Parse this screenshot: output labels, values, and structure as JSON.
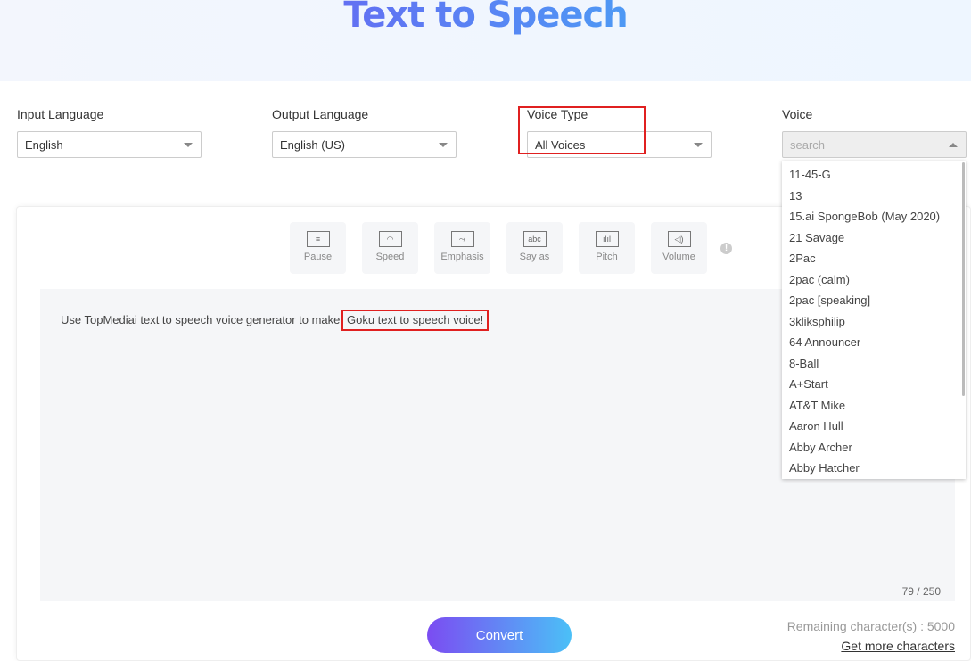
{
  "header": {
    "title": "Text to Speech"
  },
  "fields": {
    "input_language": {
      "label": "Input Language",
      "value": "English"
    },
    "output_language": {
      "label": "Output Language",
      "value": "English (US)"
    },
    "voice_type": {
      "label": "Voice Type",
      "value": "All Voices"
    },
    "voice": {
      "label": "Voice",
      "placeholder": "search"
    }
  },
  "voice_options": [
    "11-45-G",
    "13",
    "15.ai SpongeBob (May 2020)",
    "21 Savage",
    "2Pac",
    "2pac (calm)",
    "2pac [speaking]",
    "3kliksphilip",
    "64 Announcer",
    "8-Ball",
    "A+Start",
    "AT&T Mike",
    "Aaron Hull",
    "Abby Archer",
    "Abby Hatcher"
  ],
  "toolbar": [
    "Pause",
    "Speed",
    "Emphasis",
    "Say as",
    "Pitch",
    "Volume"
  ],
  "editor": {
    "text_prefix": "Use TopMediai text to speech voice generator to make ",
    "text_highlight": "Goku text to speech voice!",
    "count": "79 / 250"
  },
  "footer": {
    "convert": "Convert",
    "remaining": "Remaining character(s) : 5000",
    "more": "Get more characters"
  }
}
